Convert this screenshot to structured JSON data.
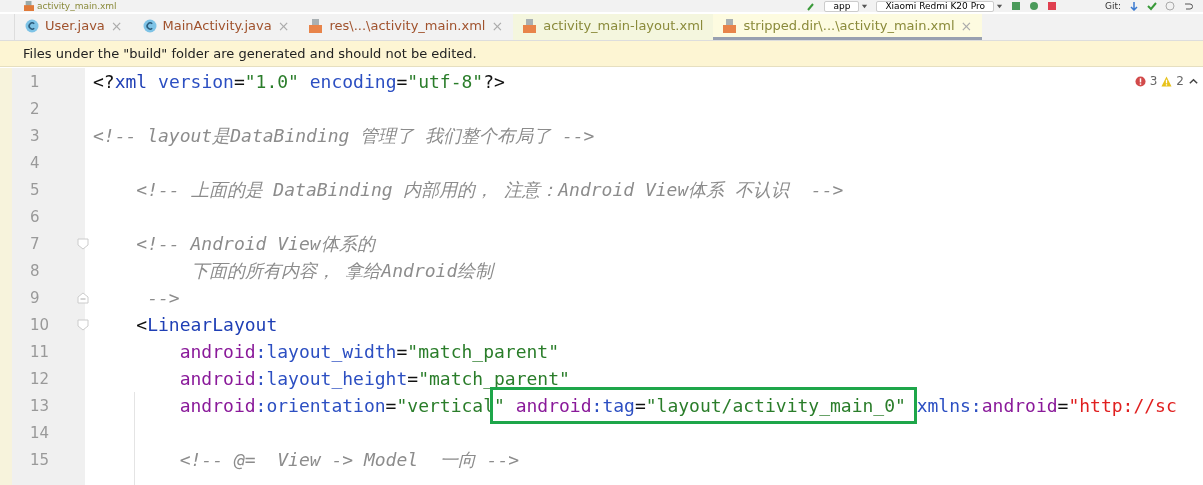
{
  "toolbar": {
    "breadcrumb": "activity_main.xml",
    "run_config": "app",
    "device": "Xiaomi Redmi K20 Pro",
    "vcs_label": "Git:"
  },
  "tabs": [
    {
      "label": "User.java",
      "kind": "class",
      "color": "#a0522d",
      "selected": false,
      "close": "×"
    },
    {
      "label": "MainActivity.java",
      "kind": "class",
      "color": "#a0522d",
      "selected": false,
      "close": "×"
    },
    {
      "label": "res\\...\\activity_main.xml",
      "kind": "xml",
      "color": "#a0522d",
      "selected": false,
      "close": "×"
    },
    {
      "label": "activity_main-layout.xml",
      "kind": "xml",
      "color": "#8a8a3a",
      "selected": false
    },
    {
      "label": "stripped.dir\\...\\activity_main.xml",
      "kind": "xml",
      "color": "#8a8a3a",
      "selected": true,
      "close": "×"
    }
  ],
  "banner": "Files under the \"build\" folder are generated and should not be edited.",
  "inspections": {
    "errors": "3",
    "warnings": "2"
  },
  "lines": [
    {
      "number": "1",
      "kind": "plain",
      "tokens": [
        {
          "kind": "punct",
          "text": "<?"
        },
        {
          "kind": "tag",
          "text": "xml"
        },
        {
          "kind": "attr",
          "text": " version"
        },
        {
          "kind": "punct",
          "text": "="
        },
        {
          "kind": "value",
          "text": "\"1.0\""
        },
        {
          "kind": "attr",
          "text": " encoding"
        },
        {
          "kind": "punct",
          "text": "="
        },
        {
          "kind": "value",
          "text": "\"utf-8\""
        },
        {
          "kind": "punct",
          "text": "?>"
        }
      ]
    },
    {
      "number": "2",
      "kind": "plain"
    },
    {
      "number": "3",
      "kind": "plain",
      "tokens": [
        {
          "kind": "comment",
          "text": "<!-- layout是DataBinding 管理了 我们整个布局了 -->"
        }
      ]
    },
    {
      "number": "4",
      "kind": "plain"
    },
    {
      "number": "5",
      "kind": "plain",
      "tokens": [
        {
          "kind": "comment",
          "text": "    <!-- 上面的是 DataBinding 内部用的， 注意：Android View体系 不认识  -->"
        }
      ]
    },
    {
      "number": "6",
      "kind": "plain"
    },
    {
      "number": "7",
      "kind": "fold_start",
      "tokens": [
        {
          "kind": "comment",
          "text": "    <!-- Android View体系的"
        }
      ]
    },
    {
      "number": "8",
      "kind": "plain",
      "tokens": [
        {
          "kind": "comment",
          "text": "         下面的所有内容， 拿给Android绘制"
        }
      ]
    },
    {
      "number": "9",
      "kind": "fold_end",
      "tokens": [
        {
          "kind": "comment",
          "text": "     -->"
        }
      ]
    },
    {
      "number": "10",
      "kind": "fold_start",
      "tokens": [
        {
          "kind": "punct",
          "text": "    <"
        },
        {
          "kind": "tag",
          "text": "LinearLayout"
        }
      ]
    },
    {
      "number": "11",
      "kind": "plain",
      "tokens": [
        {
          "kind": "ns",
          "text": "        android"
        },
        {
          "kind": "attr",
          "text": ":layout_width"
        },
        {
          "kind": "punct",
          "text": "="
        },
        {
          "kind": "value",
          "text": "\"match_parent\""
        }
      ]
    },
    {
      "number": "12",
      "kind": "plain",
      "tokens": [
        {
          "kind": "ns",
          "text": "        android"
        },
        {
          "kind": "attr",
          "text": ":layout_height"
        },
        {
          "kind": "punct",
          "text": "="
        },
        {
          "kind": "value",
          "text": "\"match_parent\""
        }
      ]
    },
    {
      "number": "13",
      "kind": "plain",
      "tokens": [
        {
          "kind": "ns",
          "text": "        android"
        },
        {
          "kind": "attr",
          "text": ":orientation"
        },
        {
          "kind": "punct",
          "text": "="
        },
        {
          "kind": "value",
          "text": "\"vertical"
        },
        {
          "kind": "frame",
          "tokens": [
            {
              "kind": "value",
              "text": "\""
            },
            {
              "kind": "ns",
              "text": " android"
            },
            {
              "kind": "attr",
              "text": ":tag"
            },
            {
              "kind": "punct",
              "text": "="
            },
            {
              "kind": "value",
              "text": "\"layout/activity_main_0\" "
            }
          ]
        },
        {
          "kind": "attr",
          "text": "xmlns:"
        },
        {
          "kind": "ns",
          "text": "android"
        },
        {
          "kind": "punct",
          "text": "="
        },
        {
          "kind": "url",
          "text": "\"http://sc"
        }
      ]
    },
    {
      "number": "14",
      "kind": "plain"
    },
    {
      "number": "15",
      "kind": "plain",
      "tokens": [
        {
          "kind": "comment",
          "text": "        <!-- @=  View -> Model  一向 -->"
        }
      ]
    }
  ]
}
